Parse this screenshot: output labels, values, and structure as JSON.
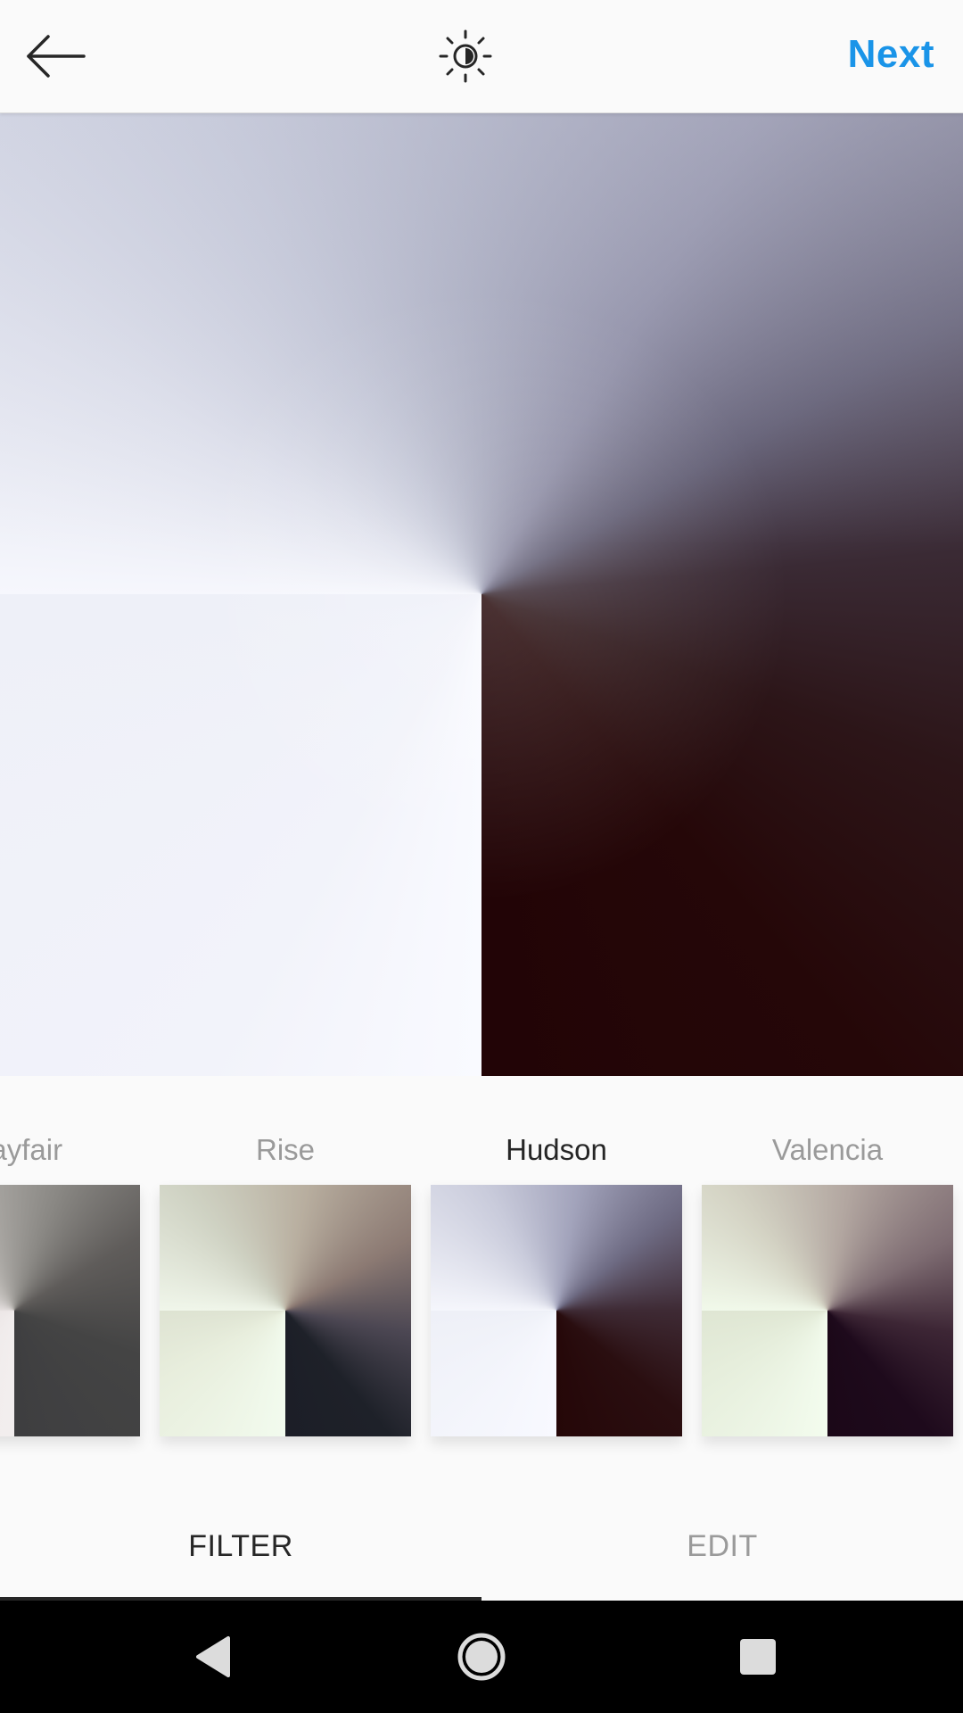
{
  "header": {
    "back_icon": "arrow-left-icon",
    "brightness_icon": "brightness-contrast-icon",
    "next_label": "Next",
    "next_color": "#1a94e8"
  },
  "filters": [
    {
      "label": "Mayfair",
      "selected": false
    },
    {
      "label": "Rise",
      "selected": false
    },
    {
      "label": "Hudson",
      "selected": true
    },
    {
      "label": "Valencia",
      "selected": false
    }
  ],
  "tabs": {
    "filter_label": "FILTER",
    "edit_label": "EDIT",
    "active": "FILTER"
  },
  "navbar": {
    "back_icon": "nav-back-icon",
    "home_icon": "nav-home-icon",
    "recents_icon": "nav-recents-icon"
  }
}
